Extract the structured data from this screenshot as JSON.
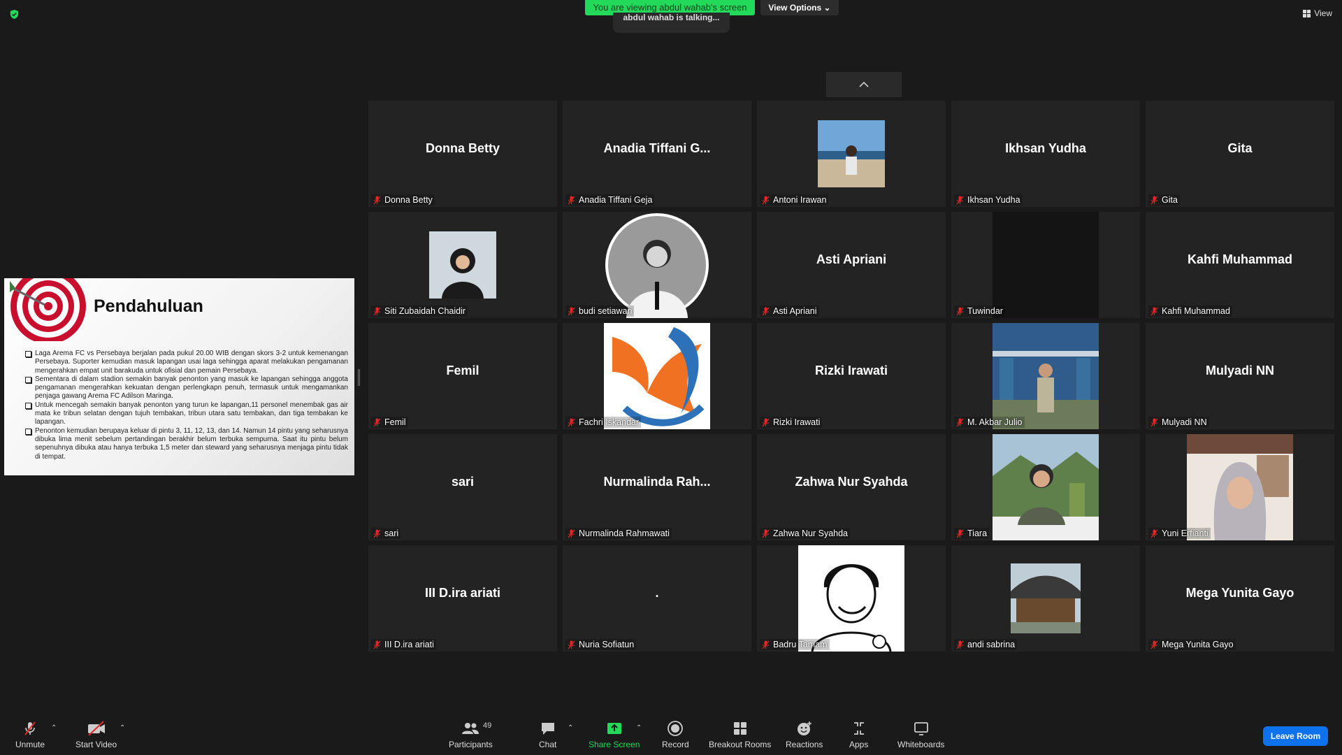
{
  "status": {
    "banner": "You are viewing abdul wahab's screen",
    "talking": "abdul wahab is talking...",
    "view_options": "View Options",
    "view": "View"
  },
  "share": {
    "title": "Pendahuluan",
    "bullets": [
      "Laga Arema FC vs Persebaya berjalan pada pukul 20.00 WIB dengan skors 3-2 untuk kemenangan Persebaya. Suporter kemudian masuk lapangan usai laga sehingga aparat melakukan pengamanan mengerahkan empat unit barakuda untuk ofisial dan pemain Persebaya.",
      "Sementara di dalam stadion semakin banyak penonton yang masuk ke lapangan sehingga anggota pengamanan mengerahkan kekuatan dengan perlengkapn penuh, termasuk untuk mengamankan penjaga gawang Arema FC Adilson Maringa.",
      "Untuk mencegah semakin banyak penonton yang turun ke lapangan,11 personel menembak gas air mata ke tribun selatan dengan tujuh tembakan, tribun utara satu tembakan, dan tiga tembakan ke lapangan.",
      "Penonton kemudian berupaya keluar di pintu 3, 11, 12, 13, dan 14. Namun 14 pintu yang seharusnya dibuka lima menit sebelum pertandingan berakhir belum terbuka sempurna. Saat itu pintu belum sepenuhnya dibuka atau hanya terbuka 1,5 meter dan steward yang seharusnya menjaga pintu tidak di tempat."
    ]
  },
  "tiles": [
    {
      "name": "Donna Betty",
      "label": "Donna Betty",
      "photo": ""
    },
    {
      "name": "Anadia  Tiffani  G...",
      "label": "Anadia Tiffani Geja",
      "photo": ""
    },
    {
      "name": "",
      "label": "Antoni Irawan",
      "photo": "landscape"
    },
    {
      "name": "Ikhsan Yudha",
      "label": "Ikhsan Yudha",
      "photo": ""
    },
    {
      "name": "Gita",
      "label": "Gita",
      "photo": ""
    },
    {
      "name": "",
      "label": "Siti Zubaidah Chaidir",
      "photo": "hijab-small"
    },
    {
      "name": "",
      "label": "budi setiawan",
      "photo": "circle-bw"
    },
    {
      "name": "Asti Apriani",
      "label": "Asti Apriani",
      "photo": ""
    },
    {
      "name": "",
      "label": "Tuwindar",
      "photo": "dark"
    },
    {
      "name": "Kahfi Muhammad",
      "label": "Kahfi Muhammad",
      "photo": ""
    },
    {
      "name": "Femil",
      "label": "Femil",
      "photo": ""
    },
    {
      "name": "",
      "label": "Fachri Iskandar",
      "photo": "logo"
    },
    {
      "name": "Rizki Irawati",
      "label": "Rizki Irawati",
      "photo": ""
    },
    {
      "name": "",
      "label": "M. Akbar Julio",
      "photo": "factory"
    },
    {
      "name": "Mulyadi NN",
      "label": "Mulyadi NN",
      "photo": ""
    },
    {
      "name": "sari",
      "label": "sari",
      "photo": ""
    },
    {
      "name": "Nurmalinda  Rah...",
      "label": "Nurmalinda Rahmawati",
      "photo": ""
    },
    {
      "name": "Zahwa Nur Syahda",
      "label": "Zahwa Nur Syahda",
      "photo": ""
    },
    {
      "name": "",
      "label": "Tiara",
      "photo": "outdoor"
    },
    {
      "name": "",
      "label": "Yuni Erfianti",
      "photo": "hijab-video"
    },
    {
      "name": "III D.ira ariati",
      "label": "III D.ira ariati",
      "photo": ""
    },
    {
      "name": ".",
      "label": "Nuria Sofiatun",
      "photo": ""
    },
    {
      "name": "",
      "label": "Badru Tamam",
      "photo": "sketch"
    },
    {
      "name": "",
      "label": "andi sabrina",
      "photo": "house"
    },
    {
      "name": "Mega Yunita Gayo",
      "label": "Mega Yunita Gayo",
      "photo": ""
    }
  ],
  "toolbar": {
    "unmute": "Unmute",
    "start_video": "Start Video",
    "participants": "Participants",
    "participants_count": "49",
    "chat": "Chat",
    "share_screen": "Share Screen",
    "record": "Record",
    "breakout": "Breakout Rooms",
    "reactions": "Reactions",
    "apps": "Apps",
    "whiteboards": "Whiteboards",
    "leave": "Leave Room"
  },
  "colors": {
    "accent_green": "#23d959",
    "leave_blue": "#0e72ed",
    "mute_red": "#e02828"
  }
}
